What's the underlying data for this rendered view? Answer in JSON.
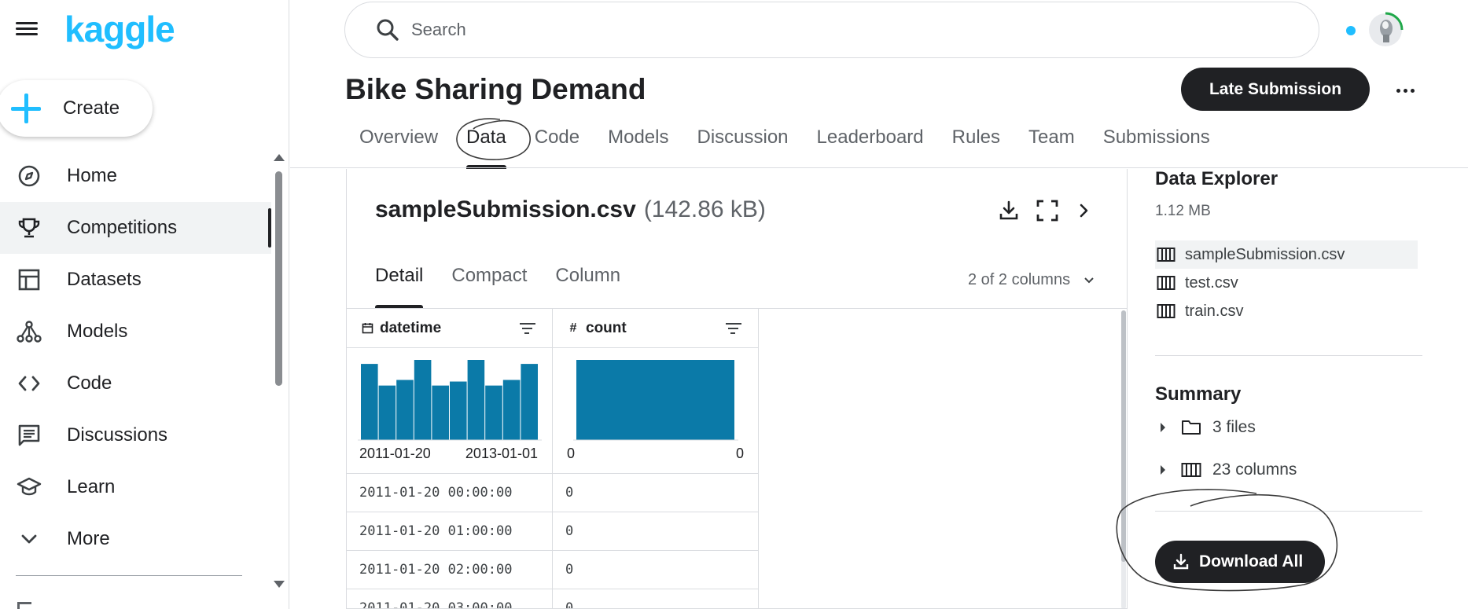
{
  "app": {
    "logo": "kaggle"
  },
  "sidebar": {
    "create_label": "Create",
    "items": [
      {
        "label": "Home",
        "icon": "compass-icon"
      },
      {
        "label": "Competitions",
        "icon": "trophy-icon",
        "active": true
      },
      {
        "label": "Datasets",
        "icon": "table-icon"
      },
      {
        "label": "Models",
        "icon": "models-icon"
      },
      {
        "label": "Code",
        "icon": "code-icon"
      },
      {
        "label": "Discussions",
        "icon": "discussion-icon"
      },
      {
        "label": "Learn",
        "icon": "graduation-cap-icon"
      },
      {
        "label": "More",
        "icon": "chevron-down-icon"
      }
    ]
  },
  "header": {
    "search_placeholder": "Search"
  },
  "competition": {
    "title": "Bike Sharing Demand",
    "late_submission_label": "Late Submission",
    "tabs": [
      "Overview",
      "Data",
      "Code",
      "Models",
      "Discussion",
      "Leaderboard",
      "Rules",
      "Team",
      "Submissions"
    ],
    "active_tab": "Data"
  },
  "file_view": {
    "file_name": "sampleSubmission.csv",
    "file_size": "(142.86 kB)",
    "subtabs": [
      "Detail",
      "Compact",
      "Column"
    ],
    "active_subtab": "Detail",
    "column_count": "2 of 2 columns",
    "columns": [
      {
        "name": "datetime",
        "type_icon": "calendar-icon",
        "range_min": "2011-01-20",
        "range_max": "2013-01-01"
      },
      {
        "name": "count",
        "type_icon": "hash-icon",
        "range_min": "0",
        "range_max": "0"
      }
    ],
    "rows": [
      [
        "2011-01-20 00:00:00",
        "0"
      ],
      [
        "2011-01-20 01:00:00",
        "0"
      ],
      [
        "2011-01-20 02:00:00",
        "0"
      ],
      [
        "2011-01-20 03:00:00",
        "0"
      ]
    ]
  },
  "chart_data": [
    {
      "type": "bar",
      "title": "",
      "xlabel": "",
      "ylabel": "",
      "categories": [
        "1",
        "2",
        "3",
        "4",
        "5",
        "6",
        "7",
        "8",
        "9",
        "10"
      ],
      "values": [
        0.95,
        0.68,
        0.75,
        1.0,
        0.68,
        0.73,
        1.0,
        0.68,
        0.75,
        0.95
      ],
      "x_range": [
        "2011-01-20",
        "2013-01-01"
      ],
      "color": "#0b7aa8"
    },
    {
      "type": "bar",
      "title": "",
      "xlabel": "",
      "ylabel": "",
      "categories": [
        "0"
      ],
      "values": [
        1.0
      ],
      "x_range": [
        "0",
        "0"
      ],
      "color": "#0b7aa8"
    }
  ],
  "data_explorer": {
    "title": "Data Explorer",
    "size": "1.12 MB",
    "files": [
      {
        "name": "sampleSubmission.csv",
        "selected": true
      },
      {
        "name": "test.csv"
      },
      {
        "name": "train.csv"
      }
    ],
    "summary_title": "Summary",
    "summary_files": "3 files",
    "summary_columns": "23 columns",
    "download_all_label": "Download All"
  },
  "colors": {
    "brand": "#20beff",
    "primary_button": "#202124",
    "chart_bar": "#0b7aa8",
    "active_tab": "#202124"
  }
}
